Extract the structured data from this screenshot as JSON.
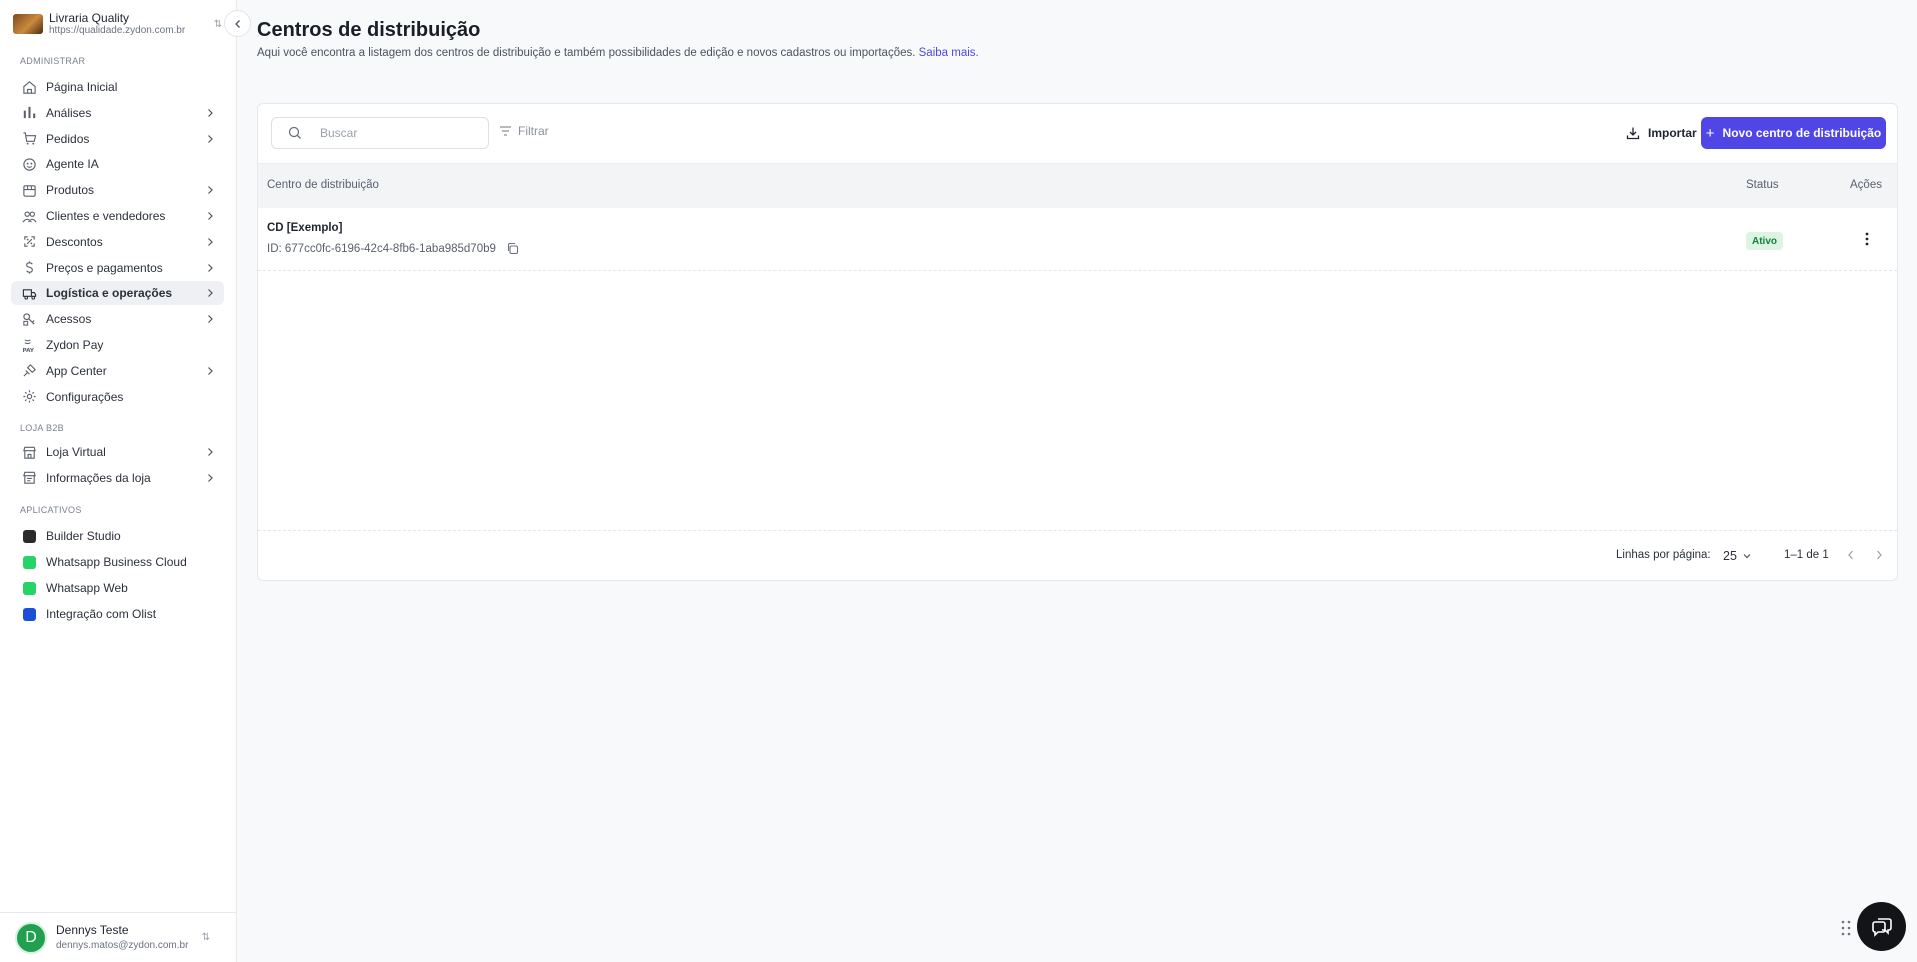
{
  "store": {
    "name": "Livraria Quality",
    "url": "https://qualidade.zydon.com.br"
  },
  "sections": {
    "admin": "ADMINISTRAR",
    "b2b": "LOJA B2B",
    "apps": "APLICATIVOS"
  },
  "nav": [
    {
      "label": "Página Inicial",
      "icon": "home-icon",
      "chevron": false
    },
    {
      "label": "Análises",
      "icon": "bar-chart-icon",
      "chevron": true
    },
    {
      "label": "Pedidos",
      "icon": "cart-icon",
      "chevron": true
    },
    {
      "label": "Agente IA",
      "icon": "ai-agent-icon",
      "chevron": false
    },
    {
      "label": "Produtos",
      "icon": "package-icon",
      "chevron": true
    },
    {
      "label": "Clientes e vendedores",
      "icon": "users-icon",
      "chevron": true
    },
    {
      "label": "Descontos",
      "icon": "discount-icon",
      "chevron": true
    },
    {
      "label": "Preços e pagamentos",
      "icon": "dollar-icon",
      "chevron": true
    },
    {
      "label": "Logística e operações",
      "icon": "truck-icon",
      "chevron": true,
      "active": true
    },
    {
      "label": "Acessos",
      "icon": "access-icon",
      "chevron": true
    },
    {
      "label": "Zydon Pay",
      "icon": "pay-icon",
      "chevron": false
    },
    {
      "label": "App Center",
      "icon": "app-center-icon",
      "chevron": true
    },
    {
      "label": "Configurações",
      "icon": "gear-icon",
      "chevron": false
    }
  ],
  "b2b_nav": [
    {
      "label": "Loja Virtual",
      "icon": "store-icon",
      "chevron": true
    },
    {
      "label": "Informações da loja",
      "icon": "info-icon",
      "chevron": true
    }
  ],
  "apps": [
    {
      "label": "Builder Studio",
      "color": "#2a2a2a"
    },
    {
      "label": "Whatsapp Business Cloud",
      "color": "#25d366"
    },
    {
      "label": "Whatsapp Web",
      "color": "#25d366"
    },
    {
      "label": "Integração com Olist",
      "color": "#1d4ed8"
    }
  ],
  "user": {
    "initial": "D",
    "name": "Dennys Teste",
    "email": "dennys.matos@zydon.com.br"
  },
  "page": {
    "title": "Centros de distribuição",
    "subtitle": "Aqui você encontra a listagem dos centros de distribuição e também possibilidades de edição e novos cadastros ou importações.",
    "more_link": "Saiba mais."
  },
  "toolbar": {
    "search_placeholder": "Buscar",
    "filter_label": "Filtrar",
    "import_label": "Importar",
    "new_label": "Novo centro de distribuição"
  },
  "table": {
    "headers": {
      "name": "Centro de distribuição",
      "status": "Status",
      "actions": "Ações"
    },
    "rows": [
      {
        "name": "CD [Exemplo]",
        "id": "ID: 677cc0fc-6196-42c4-8fb6-1aba985d70b9",
        "status": "Ativo"
      }
    ]
  },
  "pagination": {
    "rows_label": "Linhas por página:",
    "rows_value": "25",
    "range": "1–1 de 1"
  },
  "colors": {
    "accent": "#4f46e5",
    "active_bg": "#eef0f3",
    "status_green": "#14803c"
  }
}
